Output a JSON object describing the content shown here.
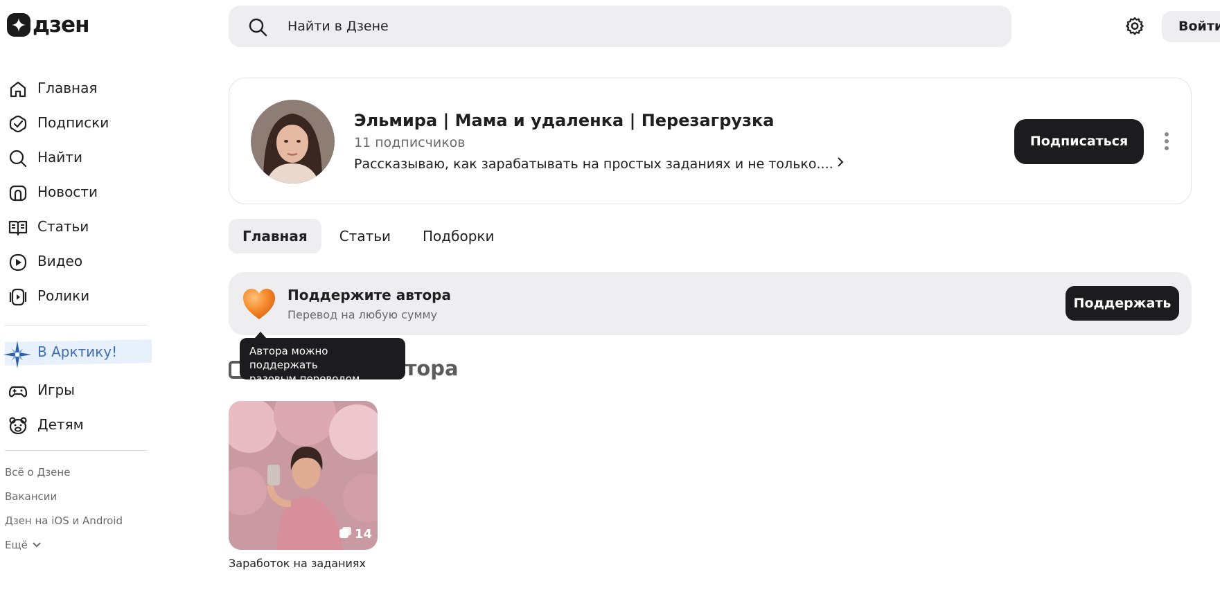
{
  "app": {
    "logo_text": "дзен"
  },
  "search": {
    "placeholder": "Найти в Дзене"
  },
  "header": {
    "login_label": "Войти"
  },
  "sidebar": {
    "items": [
      {
        "label": "Главная",
        "icon": "home-icon"
      },
      {
        "label": "Подписки",
        "icon": "subscriptions-icon"
      },
      {
        "label": "Найти",
        "icon": "search-icon"
      },
      {
        "label": "Новости",
        "icon": "news-icon"
      },
      {
        "label": "Статьи",
        "icon": "articles-icon"
      },
      {
        "label": "Видео",
        "icon": "video-icon"
      },
      {
        "label": "Ролики",
        "icon": "shorts-icon"
      }
    ],
    "promo": {
      "label": "В Арктику!",
      "icon": "compass-star-icon"
    },
    "extra": [
      {
        "label": "Игры",
        "icon": "gamepad-icon"
      },
      {
        "label": "Детям",
        "icon": "bear-icon"
      }
    ],
    "footer": {
      "about": "Всё о Дзене",
      "jobs": "Вакансии",
      "apps": "Дзен на iOS и Android",
      "more": "Ещё"
    }
  },
  "channel": {
    "title": "Эльмира | Мама и удаленка | Перезагрузка",
    "subscribers": "11 подписчиков",
    "description": "Рассказываю, как зарабатывать на простых заданиях и не только....",
    "subscribe_label": "Подписаться"
  },
  "tabs": [
    {
      "label": "Главная",
      "active": true
    },
    {
      "label": "Статьи",
      "active": false
    },
    {
      "label": "Подборки",
      "active": false
    }
  ],
  "support": {
    "title": "Поддержите автора",
    "subtitle": "Перевод на любую сумму",
    "button_label": "Поддержать"
  },
  "tooltip": {
    "line1": "Автора можно поддержать",
    "line2": "разовым переводом"
  },
  "collections": {
    "section_title": "Подборки автора",
    "items": [
      {
        "caption": "Заработок на заданиях",
        "count": "14"
      }
    ]
  },
  "colors": {
    "accent_dark": "#1c1c1e",
    "surface": "#eeeef0",
    "promo_blue": "#3e6fb5"
  }
}
